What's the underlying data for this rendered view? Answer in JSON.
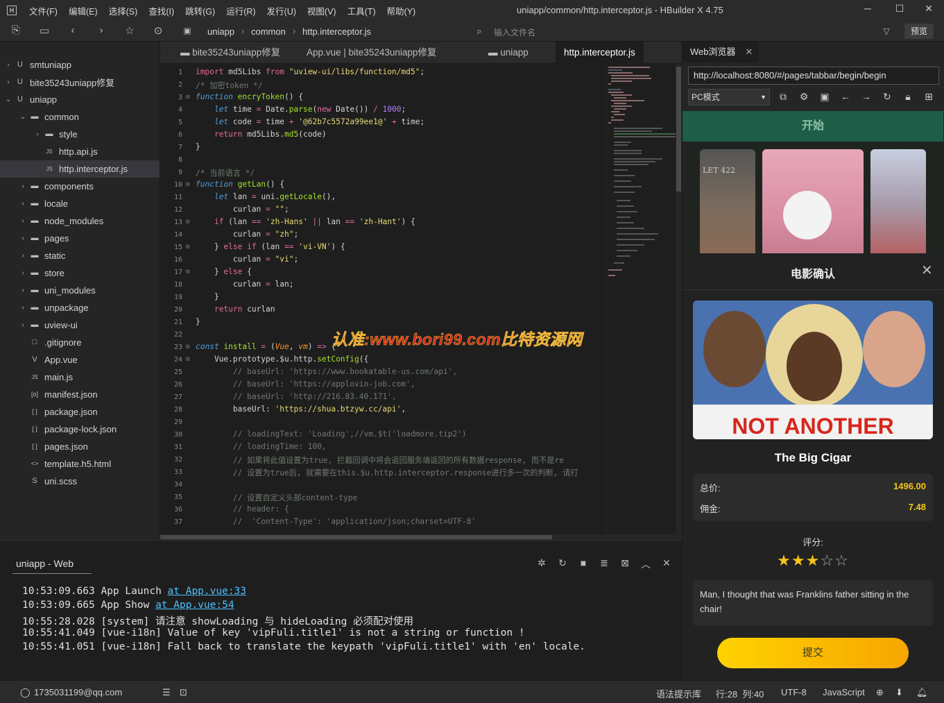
{
  "window": {
    "title": "uniapp/common/http.interceptor.js - HBuilder X 4.75",
    "menu": [
      "文件(F)",
      "编辑(E)",
      "选择(S)",
      "查找(I)",
      "跳转(G)",
      "运行(R)",
      "发行(U)",
      "视图(V)",
      "工具(T)",
      "帮助(Y)"
    ]
  },
  "toolbar": {
    "breadcrumb": [
      "uniapp",
      "common",
      "http.interceptor.js"
    ],
    "search_placeholder": "输入文件名",
    "preview_label": "预览"
  },
  "sidebar": {
    "items": [
      {
        "label": "smtuniapp",
        "arrow": "›",
        "icon": "U"
      },
      {
        "label": "bite35243uniapp修复",
        "arrow": "›",
        "icon": "U"
      },
      {
        "label": "uniapp",
        "arrow": "⌄",
        "icon": "U"
      },
      {
        "label": "common",
        "arrow": "⌄",
        "icon": "▬"
      },
      {
        "label": "style",
        "arrow": "›",
        "icon": "▬"
      },
      {
        "label": "http.api.js",
        "arrow": "",
        "icon": "JS"
      },
      {
        "label": "http.interceptor.js",
        "arrow": "",
        "icon": "JS"
      },
      {
        "label": "components",
        "arrow": "›",
        "icon": "▬"
      },
      {
        "label": "locale",
        "arrow": "›",
        "icon": "▬"
      },
      {
        "label": "node_modules",
        "arrow": "›",
        "icon": "▬"
      },
      {
        "label": "pages",
        "arrow": "›",
        "icon": "▬"
      },
      {
        "label": "static",
        "arrow": "›",
        "icon": "▬"
      },
      {
        "label": "store",
        "arrow": "›",
        "icon": "▬"
      },
      {
        "label": "uni_modules",
        "arrow": "›",
        "icon": "▬"
      },
      {
        "label": "unpackage",
        "arrow": "›",
        "icon": "▬"
      },
      {
        "label": "uview-ui",
        "arrow": "›",
        "icon": "▬"
      },
      {
        "label": ".gitignore",
        "arrow": "",
        "icon": "□"
      },
      {
        "label": "App.vue",
        "arrow": "",
        "icon": "V"
      },
      {
        "label": "main.js",
        "arrow": "",
        "icon": "JS"
      },
      {
        "label": "manifest.json",
        "arrow": "",
        "icon": "[o]"
      },
      {
        "label": "package.json",
        "arrow": "",
        "icon": "[ ]"
      },
      {
        "label": "package-lock.json",
        "arrow": "",
        "icon": "[ ]"
      },
      {
        "label": "pages.json",
        "arrow": "",
        "icon": "[ ]"
      },
      {
        "label": "template.h5.html",
        "arrow": "",
        "icon": "<>"
      },
      {
        "label": "uni.scss",
        "arrow": "",
        "icon": "S"
      }
    ]
  },
  "tabs": [
    "bite35243uniapp修复",
    "App.vue | bite35243uniapp修复",
    "uniapp",
    "http.interceptor.js"
  ],
  "editor": {
    "lines": [
      "1",
      "2",
      "3",
      "4",
      "5",
      "6",
      "7",
      "8",
      "9",
      "10",
      "11",
      "12",
      "13",
      "14",
      "15",
      "16",
      "17",
      "18",
      "19",
      "20",
      "21",
      "22",
      "23",
      "24",
      "25",
      "26",
      "27",
      "28",
      "29",
      "30",
      "31",
      "32",
      "33",
      "34",
      "35",
      "36",
      "37"
    ]
  },
  "watermark": "认准:www.bori99.com比特资源网",
  "console": {
    "tab": "uniapp - Web",
    "logs": [
      {
        "time": "10:53:09.663",
        "text": "App Launch ",
        "link": "at App.vue:33"
      },
      {
        "time": "10:53:09.665",
        "text": "App Show ",
        "link": "at App.vue:54"
      },
      {
        "time": "10:55:28.028",
        "text": "[system] 请注意 showLoading 与 hideLoading 必须配对使用",
        "link": ""
      },
      {
        "time": "10:55:41.049",
        "text": "[vue-i18n] Value of key 'vipFuli.title1' is not a string or function !",
        "link": ""
      },
      {
        "time": "10:55:41.051",
        "text": "[vue-i18n] Fall back to translate the keypath 'vipFuli.title1' with 'en' locale.",
        "link": ""
      }
    ]
  },
  "browser": {
    "tab": "Web浏览器",
    "url": "http://localhost:8080/#/pages/tabbar/begin/begin",
    "mode": "PC模式",
    "page_header": "开始",
    "poster_text": "LET 422",
    "sheet": {
      "title": "电影确认",
      "movie_poster_text": "NOT ANOTHER",
      "movie_name": "The Big Cigar",
      "total_label": "总价:",
      "total_value": "1496.00",
      "commission_label": "佣金:",
      "commission_value": "7.48",
      "rating_label": "评分:",
      "rating": 3,
      "rating_max": 5,
      "comment": "Man, I thought that was Franklins father sitting in the chair!",
      "submit_label": "提交"
    }
  },
  "statusbar": {
    "account": "1735031199@qq.com",
    "hint_lib": "语法提示库",
    "position": "行:28  列:40",
    "encoding": "UTF-8",
    "language": "JavaScript"
  },
  "colors": {
    "accent_green": "#1e5e48",
    "star": "#f5c518",
    "submit": "#ffd200"
  }
}
